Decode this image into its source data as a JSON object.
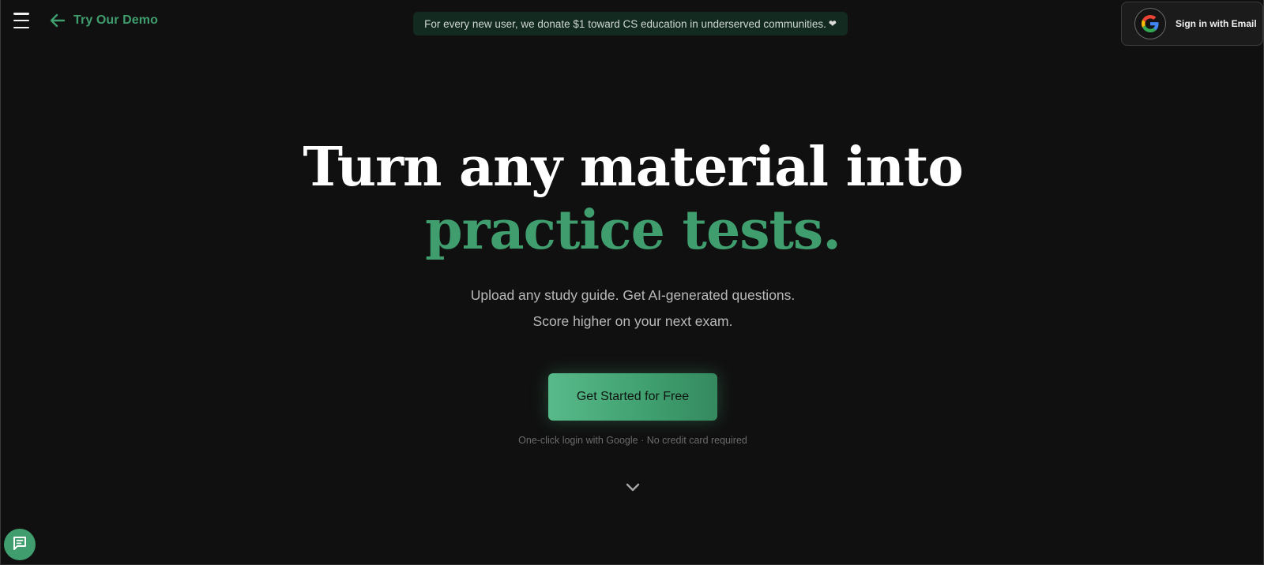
{
  "header": {
    "demo_link": {
      "label": "Try Our Demo",
      "icon": "arrow-left-icon"
    },
    "menu_icon": "hamburger-menu-icon",
    "banner": {
      "text": "For every new user, we donate $1 toward CS education in underserved communities.",
      "heart": "❤"
    },
    "signin": {
      "label": "Sign in with Email",
      "icon": "google-icon"
    }
  },
  "hero": {
    "title_line1": "Turn any material into",
    "title_line2": "practice tests.",
    "subtitle_line1": "Upload any study guide. Get AI-generated questions.",
    "subtitle_line2": "Score higher on your next exam.",
    "cta_label": "Get Started for Free",
    "fine_print": "One-click login with Google · No credit card required",
    "scroll_icon": "chevron-down-icon"
  },
  "chat": {
    "icon": "chat-icon"
  },
  "colors": {
    "accent": "#3f9d6e",
    "background": "#101010",
    "banner_background": "#132a20"
  }
}
